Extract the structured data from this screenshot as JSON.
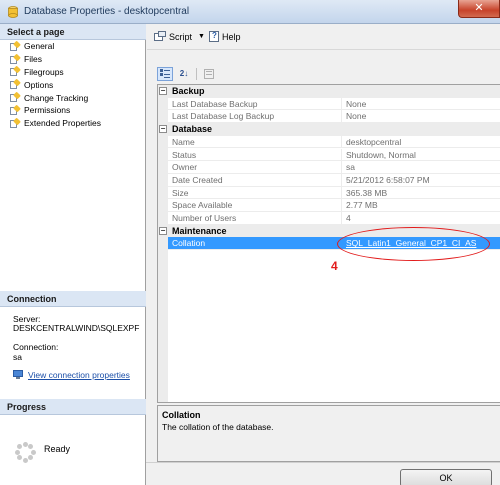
{
  "window": {
    "title": "Database Properties - desktopcentral",
    "close_glyph": "✕"
  },
  "left_panel": {
    "select_page_header": "Select a page",
    "pages": [
      {
        "label": "General",
        "selected": true
      },
      {
        "label": "Files"
      },
      {
        "label": "Filegroups"
      },
      {
        "label": "Options"
      },
      {
        "label": "Change Tracking"
      },
      {
        "label": "Permissions"
      },
      {
        "label": "Extended Properties"
      }
    ],
    "connection_header": "Connection",
    "server_label": "Server:",
    "server_value": "DESKCENTRALWIND\\SQLEXPF",
    "connection_label": "Connection:",
    "connection_value": "sa",
    "view_link": "View connection properties",
    "progress_header": "Progress",
    "progress_status": "Ready"
  },
  "toolbar": {
    "script_label": "Script",
    "help_label": "Help",
    "dropdown_glyph": "▼"
  },
  "grid_toolbar": {
    "categorized_icon": "categorized-icon",
    "alphabetical_icon": "alphabetical-sort-icon",
    "alpha_glyph": "2↓",
    "pages_icon": "property-pages-icon"
  },
  "property_grid": {
    "expander_glyph": "−",
    "categories": [
      {
        "name": "Backup",
        "properties": [
          {
            "name": "Last Database Backup",
            "value": "None"
          },
          {
            "name": "Last Database Log Backup",
            "value": "None"
          }
        ]
      },
      {
        "name": "Database",
        "properties": [
          {
            "name": "Name",
            "value": "desktopcentral"
          },
          {
            "name": "Status",
            "value": "Shutdown, Normal"
          },
          {
            "name": "Owner",
            "value": "sa"
          },
          {
            "name": "Date Created",
            "value": "5/21/2012 6:58:07 PM"
          },
          {
            "name": "Size",
            "value": "365.38 MB"
          },
          {
            "name": "Space Available",
            "value": "2.77 MB"
          },
          {
            "name": "Number of Users",
            "value": "4"
          }
        ]
      },
      {
        "name": "Maintenance",
        "properties": [
          {
            "name": "Collation",
            "value": "SQL_Latin1_General_CP1_CI_AS",
            "selected": true
          }
        ]
      }
    ]
  },
  "annotation": {
    "number": "4",
    "color": "#e21b1b"
  },
  "description": {
    "title": "Collation",
    "text": "The collation of the database."
  },
  "buttons": {
    "ok": "OK"
  }
}
